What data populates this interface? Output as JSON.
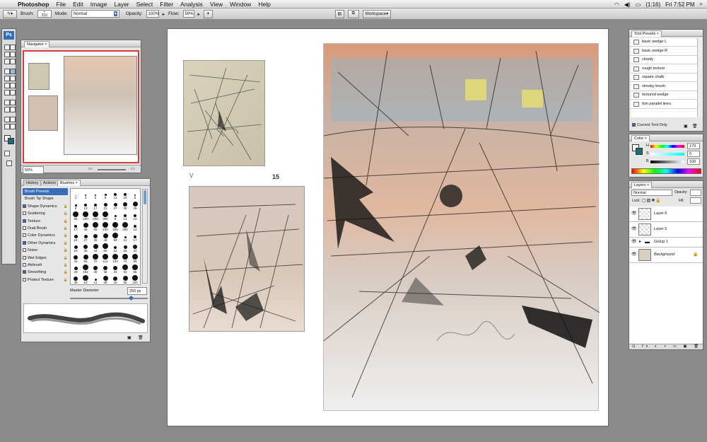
{
  "menubar": {
    "app_name": "Photoshop",
    "items": [
      "File",
      "Edit",
      "Image",
      "Layer",
      "Select",
      "Filter",
      "Analysis",
      "View",
      "Window",
      "Help"
    ],
    "status": {
      "battery": "(1:16)",
      "clock": "Fri 7:52 PM"
    }
  },
  "options_bar": {
    "brush_label": "Brush:",
    "brush_size": "210",
    "mode_label": "Mode:",
    "mode_value": "Normal",
    "opacity_label": "Opacity:",
    "opacity_value": "100%",
    "flow_label": "Flow:",
    "flow_value": "50%",
    "workspace_label": "Workspace"
  },
  "toolbox": {
    "logo": "Ps"
  },
  "navigator": {
    "tab": "Navigator",
    "zoom": "50%"
  },
  "brushes_panel": {
    "tabs": [
      "History",
      "Actions",
      "Brushes"
    ],
    "options": [
      {
        "label": "Brush Presets",
        "checked": null,
        "lock": false,
        "selected": true
      },
      {
        "label": "Brush Tip Shape",
        "checked": null,
        "lock": false,
        "selected": false
      },
      {
        "label": "Shape Dynamics",
        "checked": true,
        "lock": true,
        "selected": false
      },
      {
        "label": "Scattering",
        "checked": false,
        "lock": true,
        "selected": false
      },
      {
        "label": "Texture",
        "checked": true,
        "lock": true,
        "selected": false
      },
      {
        "label": "Dual Brush",
        "checked": false,
        "lock": true,
        "selected": false
      },
      {
        "label": "Color Dynamics",
        "checked": false,
        "lock": true,
        "selected": false
      },
      {
        "label": "Other Dynamics",
        "checked": true,
        "lock": true,
        "selected": false
      },
      {
        "label": "Noise",
        "checked": false,
        "lock": true,
        "selected": false
      },
      {
        "label": "Wet Edges",
        "checked": false,
        "lock": true,
        "selected": false
      },
      {
        "label": "Airbrush",
        "checked": false,
        "lock": true,
        "selected": false
      },
      {
        "label": "Smoothing",
        "checked": true,
        "lock": true,
        "selected": false
      },
      {
        "label": "Protect Texture",
        "checked": false,
        "lock": true,
        "selected": false
      }
    ],
    "sizes": [
      "1",
      "3",
      "5",
      "9",
      "13",
      "19",
      "5",
      "9",
      "13",
      "17",
      "21",
      "27",
      "35",
      "45",
      "65",
      "100",
      "200",
      "300",
      "9",
      "13",
      "19",
      "17",
      "45",
      "65",
      "100",
      "200",
      "300",
      "14",
      "24",
      "27",
      "39",
      "46",
      "59",
      "11",
      "17",
      "23",
      "36",
      "44",
      "60",
      "14",
      "26",
      "33",
      "42",
      "55",
      "70",
      "112",
      "134",
      "74",
      "95",
      "29",
      "192",
      "36",
      "36",
      "33",
      "63",
      "66",
      "39",
      "63",
      "11",
      "48",
      "32",
      "55",
      "100",
      "75",
      "45"
    ],
    "master_diameter_label": "Master Diameter",
    "master_diameter_value": "250 px"
  },
  "tool_presets": {
    "tab": "Tool Presets",
    "items": [
      "basic wedge L",
      "basic wedge R",
      "cloudy",
      "rough texture",
      "square chalk",
      "streaky brush",
      "textured wedge",
      "thin parallel lines"
    ],
    "current_tool_only_label": "Current Tool Only"
  },
  "color_panel": {
    "tab": "Color",
    "channels": [
      {
        "label": "H",
        "value": "179"
      },
      {
        "label": "S",
        "value": "0"
      },
      {
        "label": "B",
        "value": "100"
      }
    ]
  },
  "layers_panel": {
    "tab": "Layers",
    "blend_mode": "Normal",
    "opacity_label": "Opacity:",
    "lock_label": "Lock:",
    "fill_label": "Fill:",
    "layers": [
      "Layer 6",
      "Layer 5",
      "Group 1",
      "Background"
    ]
  },
  "canvas": {
    "page_number": "15",
    "corner_mark": "V"
  }
}
